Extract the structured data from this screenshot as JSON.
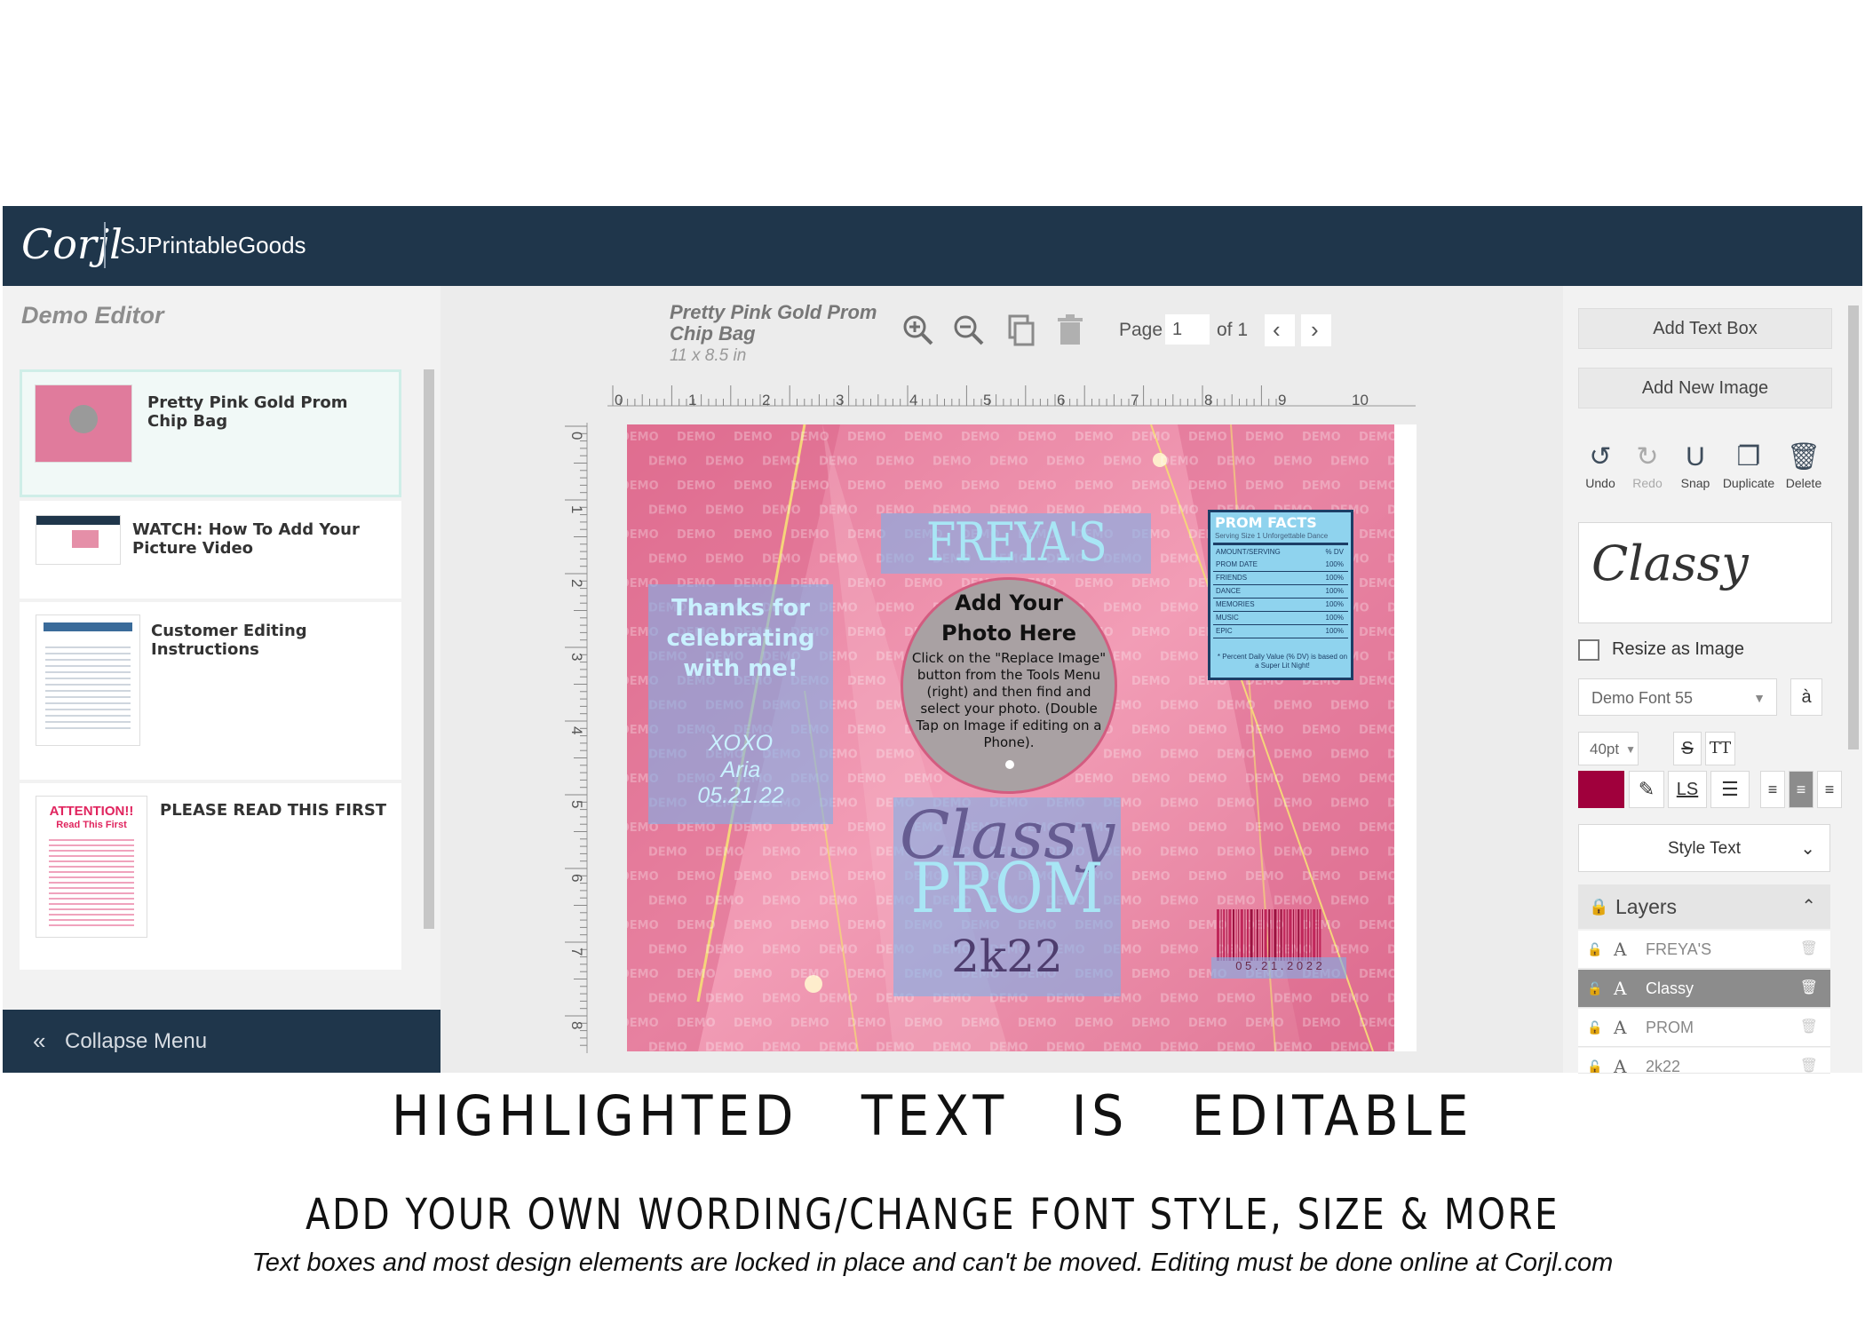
{
  "app": {
    "logo": "Corjl",
    "shop_name": "SJPrintableGoods",
    "panel_title": "Demo Editor",
    "collapse_label": "Collapse Menu"
  },
  "projects": [
    {
      "title": "Pretty Pink Gold Prom Chip Bag",
      "thumb_icon": "chip-bag-thumbnail"
    },
    {
      "title": "WATCH: How To Add Your Picture Video",
      "thumb_icon": "video-thumbnail"
    },
    {
      "title": "Customer Editing Instructions",
      "thumb_icon": "instructions-thumbnail"
    },
    {
      "title": "PLEASE READ THIS FIRST",
      "thumb_icon": "attention-thumbnail",
      "thumb_heading": "ATTENTION!!",
      "thumb_sub": "Read This First"
    }
  ],
  "document": {
    "name": "Pretty Pink Gold Prom Chip Bag",
    "size": "11 x 8.5 in",
    "page_label": "Page",
    "page_value": "1",
    "page_of": "of 1"
  },
  "toolbar_icons": [
    "zoom-in-icon",
    "zoom-out-icon",
    "copy-icon",
    "trash-icon"
  ],
  "ruler": {
    "top": [
      "0",
      "1",
      "2",
      "3",
      "4",
      "5",
      "6",
      "7",
      "8",
      "9",
      "10"
    ],
    "left": [
      "0",
      "1",
      "2",
      "3",
      "4",
      "5",
      "6",
      "7",
      "8"
    ]
  },
  "design": {
    "title": "FREYA'S",
    "thanks": "Thanks for celebrating with me!",
    "xoxo": "XOXO",
    "name": "Aria",
    "date": "05.21.22",
    "photo_title": "Add Your Photo Here",
    "photo_instructions": "Click on the \"Replace Image\" button from the Tools Menu (right) and then find and select your photo. (Double Tap on Image if editing on a Phone).",
    "script": "Classy",
    "prom": "PROM",
    "year": "2k22",
    "barcode_date": "0 5 . 2 1 . 2 0 2 2",
    "watermark": "DEMO",
    "facts": {
      "title": "PROM FACTS",
      "subtitle": "Serving Size 1 Unforgettable Dance",
      "header_left": "AMOUNT/SERVING",
      "header_right": "% DV",
      "rows": [
        [
          "PROM DATE",
          "100%"
        ],
        [
          "FRIENDS",
          "100%"
        ],
        [
          "DANCE",
          "100%"
        ],
        [
          "MEMORIES",
          "100%"
        ],
        [
          "MUSIC",
          "100%"
        ],
        [
          "EPIC",
          "100%"
        ]
      ],
      "footnote": "* Percent Daily Value (% DV) is based on a Super Lit Night!"
    }
  },
  "right_panel": {
    "add_text": "Add Text Box",
    "add_image": "Add New Image",
    "tools": [
      {
        "label": "Undo",
        "icon": "undo-icon"
      },
      {
        "label": "Redo",
        "icon": "redo-icon"
      },
      {
        "label": "Snap",
        "icon": "magnet-icon"
      },
      {
        "label": "Duplicate",
        "icon": "duplicate-icon"
      },
      {
        "label": "Delete",
        "icon": "trash-icon"
      }
    ],
    "preview_text": "Classy",
    "resize_label": "Resize as Image",
    "font": "Demo Font 55",
    "size": "40pt",
    "ls_label": "LS",
    "tt_label": "TT",
    "color": "#a0003c",
    "style_text": "Style Text",
    "layers_title": "Layers",
    "layers": [
      {
        "name": "FREYA'S",
        "selected": false
      },
      {
        "name": "Classy",
        "selected": true
      },
      {
        "name": "PROM",
        "selected": false
      },
      {
        "name": "2k22",
        "selected": false
      }
    ]
  },
  "captions": {
    "line1": "HIGHLIGHTED   TEXT   IS   EDITABLE",
    "line2": "ADD YOUR OWN WORDING/CHANGE FONT STYLE, SIZE & MORE",
    "line3": "Text boxes and most design elements are locked in place and can't be moved. Editing must be done online at Corjl.com"
  }
}
